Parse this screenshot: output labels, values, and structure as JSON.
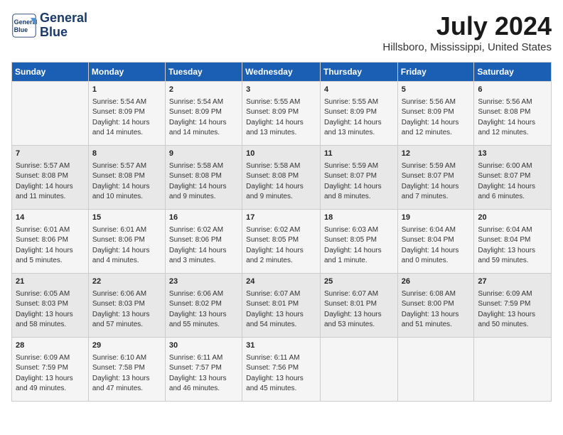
{
  "header": {
    "logo_line1": "General",
    "logo_line2": "Blue",
    "month": "July 2024",
    "location": "Hillsboro, Mississippi, United States"
  },
  "days_of_week": [
    "Sunday",
    "Monday",
    "Tuesday",
    "Wednesday",
    "Thursday",
    "Friday",
    "Saturday"
  ],
  "weeks": [
    [
      {
        "day": "",
        "content": ""
      },
      {
        "day": "1",
        "content": "Sunrise: 5:54 AM\nSunset: 8:09 PM\nDaylight: 14 hours\nand 14 minutes."
      },
      {
        "day": "2",
        "content": "Sunrise: 5:54 AM\nSunset: 8:09 PM\nDaylight: 14 hours\nand 14 minutes."
      },
      {
        "day": "3",
        "content": "Sunrise: 5:55 AM\nSunset: 8:09 PM\nDaylight: 14 hours\nand 13 minutes."
      },
      {
        "day": "4",
        "content": "Sunrise: 5:55 AM\nSunset: 8:09 PM\nDaylight: 14 hours\nand 13 minutes."
      },
      {
        "day": "5",
        "content": "Sunrise: 5:56 AM\nSunset: 8:09 PM\nDaylight: 14 hours\nand 12 minutes."
      },
      {
        "day": "6",
        "content": "Sunrise: 5:56 AM\nSunset: 8:08 PM\nDaylight: 14 hours\nand 12 minutes."
      }
    ],
    [
      {
        "day": "7",
        "content": "Sunrise: 5:57 AM\nSunset: 8:08 PM\nDaylight: 14 hours\nand 11 minutes."
      },
      {
        "day": "8",
        "content": "Sunrise: 5:57 AM\nSunset: 8:08 PM\nDaylight: 14 hours\nand 10 minutes."
      },
      {
        "day": "9",
        "content": "Sunrise: 5:58 AM\nSunset: 8:08 PM\nDaylight: 14 hours\nand 9 minutes."
      },
      {
        "day": "10",
        "content": "Sunrise: 5:58 AM\nSunset: 8:08 PM\nDaylight: 14 hours\nand 9 minutes."
      },
      {
        "day": "11",
        "content": "Sunrise: 5:59 AM\nSunset: 8:07 PM\nDaylight: 14 hours\nand 8 minutes."
      },
      {
        "day": "12",
        "content": "Sunrise: 5:59 AM\nSunset: 8:07 PM\nDaylight: 14 hours\nand 7 minutes."
      },
      {
        "day": "13",
        "content": "Sunrise: 6:00 AM\nSunset: 8:07 PM\nDaylight: 14 hours\nand 6 minutes."
      }
    ],
    [
      {
        "day": "14",
        "content": "Sunrise: 6:01 AM\nSunset: 8:06 PM\nDaylight: 14 hours\nand 5 minutes."
      },
      {
        "day": "15",
        "content": "Sunrise: 6:01 AM\nSunset: 8:06 PM\nDaylight: 14 hours\nand 4 minutes."
      },
      {
        "day": "16",
        "content": "Sunrise: 6:02 AM\nSunset: 8:06 PM\nDaylight: 14 hours\nand 3 minutes."
      },
      {
        "day": "17",
        "content": "Sunrise: 6:02 AM\nSunset: 8:05 PM\nDaylight: 14 hours\nand 2 minutes."
      },
      {
        "day": "18",
        "content": "Sunrise: 6:03 AM\nSunset: 8:05 PM\nDaylight: 14 hours\nand 1 minute."
      },
      {
        "day": "19",
        "content": "Sunrise: 6:04 AM\nSunset: 8:04 PM\nDaylight: 14 hours\nand 0 minutes."
      },
      {
        "day": "20",
        "content": "Sunrise: 6:04 AM\nSunset: 8:04 PM\nDaylight: 13 hours\nand 59 minutes."
      }
    ],
    [
      {
        "day": "21",
        "content": "Sunrise: 6:05 AM\nSunset: 8:03 PM\nDaylight: 13 hours\nand 58 minutes."
      },
      {
        "day": "22",
        "content": "Sunrise: 6:06 AM\nSunset: 8:03 PM\nDaylight: 13 hours\nand 57 minutes."
      },
      {
        "day": "23",
        "content": "Sunrise: 6:06 AM\nSunset: 8:02 PM\nDaylight: 13 hours\nand 55 minutes."
      },
      {
        "day": "24",
        "content": "Sunrise: 6:07 AM\nSunset: 8:01 PM\nDaylight: 13 hours\nand 54 minutes."
      },
      {
        "day": "25",
        "content": "Sunrise: 6:07 AM\nSunset: 8:01 PM\nDaylight: 13 hours\nand 53 minutes."
      },
      {
        "day": "26",
        "content": "Sunrise: 6:08 AM\nSunset: 8:00 PM\nDaylight: 13 hours\nand 51 minutes."
      },
      {
        "day": "27",
        "content": "Sunrise: 6:09 AM\nSunset: 7:59 PM\nDaylight: 13 hours\nand 50 minutes."
      }
    ],
    [
      {
        "day": "28",
        "content": "Sunrise: 6:09 AM\nSunset: 7:59 PM\nDaylight: 13 hours\nand 49 minutes."
      },
      {
        "day": "29",
        "content": "Sunrise: 6:10 AM\nSunset: 7:58 PM\nDaylight: 13 hours\nand 47 minutes."
      },
      {
        "day": "30",
        "content": "Sunrise: 6:11 AM\nSunset: 7:57 PM\nDaylight: 13 hours\nand 46 minutes."
      },
      {
        "day": "31",
        "content": "Sunrise: 6:11 AM\nSunset: 7:56 PM\nDaylight: 13 hours\nand 45 minutes."
      },
      {
        "day": "",
        "content": ""
      },
      {
        "day": "",
        "content": ""
      },
      {
        "day": "",
        "content": ""
      }
    ]
  ]
}
